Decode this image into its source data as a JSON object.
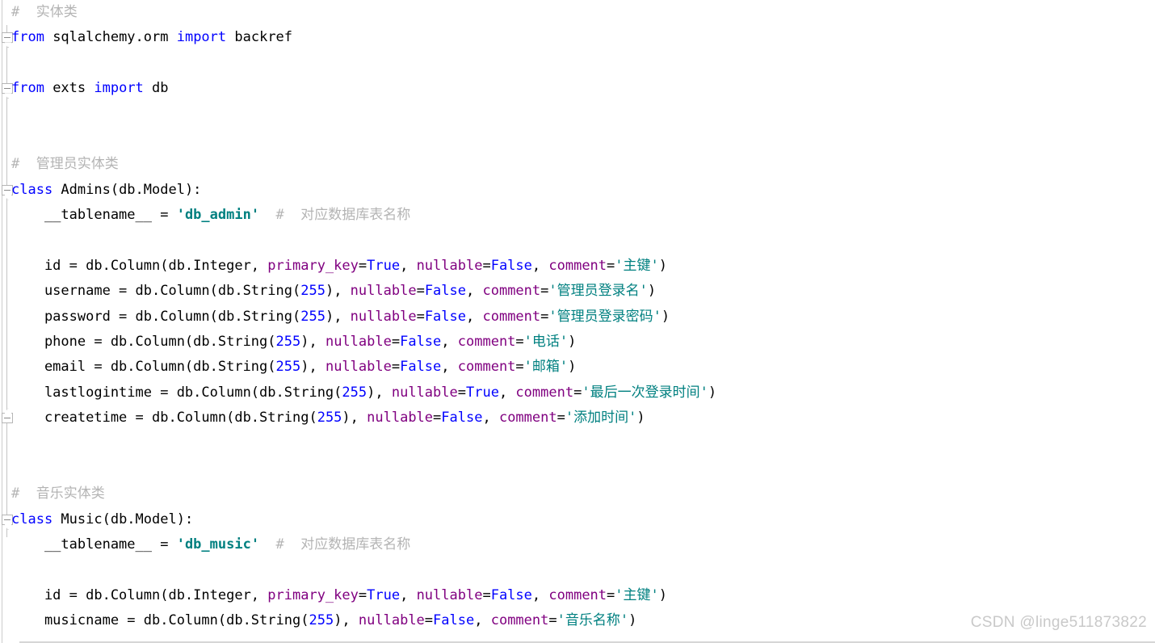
{
  "editor": {
    "background": "#ffffff",
    "font_size_px": 17,
    "line_height_px": 31.4,
    "colors": {
      "keyword": "#0000ff",
      "identifier": "#000000",
      "string": "#008080",
      "number": "#0000ff",
      "boolean": "#0000ff",
      "keyword_argument": "#800080",
      "comment": "#b4b4b4",
      "gutter_rule": "#cccccc",
      "fold_marker": "#b5b5b5",
      "watermark": "#c9c9c9"
    }
  },
  "watermark": {
    "text": "CSDN @linge511873822"
  },
  "gutter": {
    "fold_markers": [
      {
        "type": "start",
        "line_index": 1,
        "title": "collapse-region"
      },
      {
        "type": "start",
        "line_index": 3,
        "title": "collapse-region"
      },
      {
        "type": "start",
        "line_index": 7,
        "title": "collapse-region"
      },
      {
        "type": "end",
        "line_index": 16,
        "title": "end-of-region"
      },
      {
        "type": "start",
        "line_index": 20,
        "title": "collapse-region"
      }
    ]
  },
  "code": {
    "language": "python",
    "lines": [
      {
        "index": 0,
        "tokens": [
          {
            "t": "cm",
            "v": "# "
          },
          {
            "t": "cm",
            "v": " 实体类"
          }
        ]
      },
      {
        "index": 1,
        "tokens": [
          {
            "t": "kw",
            "v": "from"
          },
          {
            "t": "id",
            "v": " sqlalchemy.orm "
          },
          {
            "t": "kw",
            "v": "import"
          },
          {
            "t": "id",
            "v": " backref"
          }
        ]
      },
      {
        "index": 2,
        "tokens": []
      },
      {
        "index": 3,
        "tokens": [
          {
            "t": "kw",
            "v": "from"
          },
          {
            "t": "id",
            "v": " exts "
          },
          {
            "t": "kw",
            "v": "import"
          },
          {
            "t": "id",
            "v": " db"
          }
        ]
      },
      {
        "index": 4,
        "tokens": []
      },
      {
        "index": 5,
        "tokens": []
      },
      {
        "index": 6,
        "tokens": [
          {
            "t": "cm",
            "v": "# "
          },
          {
            "t": "cm",
            "v": " 管理员实体类"
          }
        ]
      },
      {
        "index": 7,
        "tokens": [
          {
            "t": "kw",
            "v": "class"
          },
          {
            "t": "id",
            "v": " Admins(db.Model):"
          }
        ]
      },
      {
        "index": 8,
        "tokens": [
          {
            "t": "id",
            "v": "    __tablename__ = "
          },
          {
            "t": "strb",
            "v": "'db_admin'"
          },
          {
            "t": "cm",
            "v": "  # "
          },
          {
            "t": "cm",
            "v": " 对应数据库表名称"
          }
        ]
      },
      {
        "index": 9,
        "tokens": []
      },
      {
        "index": 10,
        "tokens": [
          {
            "t": "id",
            "v": "    id = db.Column(db.Integer, "
          },
          {
            "t": "arg",
            "v": "primary_key"
          },
          {
            "t": "pn",
            "v": "="
          },
          {
            "t": "bool",
            "v": "True"
          },
          {
            "t": "pn",
            "v": ", "
          },
          {
            "t": "arg",
            "v": "nullable"
          },
          {
            "t": "pn",
            "v": "="
          },
          {
            "t": "bool",
            "v": "False"
          },
          {
            "t": "pn",
            "v": ", "
          },
          {
            "t": "arg",
            "v": "comment"
          },
          {
            "t": "pn",
            "v": "="
          },
          {
            "t": "str",
            "v": "'主键'"
          },
          {
            "t": "pn",
            "v": ")"
          }
        ]
      },
      {
        "index": 11,
        "tokens": [
          {
            "t": "id",
            "v": "    username = db.Column(db.String("
          },
          {
            "t": "num",
            "v": "255"
          },
          {
            "t": "pn",
            "v": "), "
          },
          {
            "t": "arg",
            "v": "nullable"
          },
          {
            "t": "pn",
            "v": "="
          },
          {
            "t": "bool",
            "v": "False"
          },
          {
            "t": "pn",
            "v": ", "
          },
          {
            "t": "arg",
            "v": "comment"
          },
          {
            "t": "pn",
            "v": "="
          },
          {
            "t": "str",
            "v": "'管理员登录名'"
          },
          {
            "t": "pn",
            "v": ")"
          }
        ]
      },
      {
        "index": 12,
        "tokens": [
          {
            "t": "id",
            "v": "    password = db.Column(db.String("
          },
          {
            "t": "num",
            "v": "255"
          },
          {
            "t": "pn",
            "v": "), "
          },
          {
            "t": "arg",
            "v": "nullable"
          },
          {
            "t": "pn",
            "v": "="
          },
          {
            "t": "bool",
            "v": "False"
          },
          {
            "t": "pn",
            "v": ", "
          },
          {
            "t": "arg",
            "v": "comment"
          },
          {
            "t": "pn",
            "v": "="
          },
          {
            "t": "str",
            "v": "'管理员登录密码'"
          },
          {
            "t": "pn",
            "v": ")"
          }
        ]
      },
      {
        "index": 13,
        "tokens": [
          {
            "t": "id",
            "v": "    phone = db.Column(db.String("
          },
          {
            "t": "num",
            "v": "255"
          },
          {
            "t": "pn",
            "v": "), "
          },
          {
            "t": "arg",
            "v": "nullable"
          },
          {
            "t": "pn",
            "v": "="
          },
          {
            "t": "bool",
            "v": "False"
          },
          {
            "t": "pn",
            "v": ", "
          },
          {
            "t": "arg",
            "v": "comment"
          },
          {
            "t": "pn",
            "v": "="
          },
          {
            "t": "str",
            "v": "'电话'"
          },
          {
            "t": "pn",
            "v": ")"
          }
        ]
      },
      {
        "index": 14,
        "tokens": [
          {
            "t": "id",
            "v": "    email = db.Column(db.String("
          },
          {
            "t": "num",
            "v": "255"
          },
          {
            "t": "pn",
            "v": "), "
          },
          {
            "t": "arg",
            "v": "nullable"
          },
          {
            "t": "pn",
            "v": "="
          },
          {
            "t": "bool",
            "v": "False"
          },
          {
            "t": "pn",
            "v": ", "
          },
          {
            "t": "arg",
            "v": "comment"
          },
          {
            "t": "pn",
            "v": "="
          },
          {
            "t": "str",
            "v": "'邮箱'"
          },
          {
            "t": "pn",
            "v": ")"
          }
        ]
      },
      {
        "index": 15,
        "tokens": [
          {
            "t": "id",
            "v": "    lastlogintime = db.Column(db.String("
          },
          {
            "t": "num",
            "v": "255"
          },
          {
            "t": "pn",
            "v": "), "
          },
          {
            "t": "arg",
            "v": "nullable"
          },
          {
            "t": "pn",
            "v": "="
          },
          {
            "t": "bool",
            "v": "True"
          },
          {
            "t": "pn",
            "v": ", "
          },
          {
            "t": "arg",
            "v": "comment"
          },
          {
            "t": "pn",
            "v": "="
          },
          {
            "t": "str",
            "v": "'最后一次登录时间'"
          },
          {
            "t": "pn",
            "v": ")"
          }
        ]
      },
      {
        "index": 16,
        "tokens": [
          {
            "t": "id",
            "v": "    createtime = db.Column(db.String("
          },
          {
            "t": "num",
            "v": "255"
          },
          {
            "t": "pn",
            "v": "), "
          },
          {
            "t": "arg",
            "v": "nullable"
          },
          {
            "t": "pn",
            "v": "="
          },
          {
            "t": "bool",
            "v": "False"
          },
          {
            "t": "pn",
            "v": ", "
          },
          {
            "t": "arg",
            "v": "comment"
          },
          {
            "t": "pn",
            "v": "="
          },
          {
            "t": "str",
            "v": "'添加时间'"
          },
          {
            "t": "pn",
            "v": ")"
          }
        ]
      },
      {
        "index": 17,
        "tokens": []
      },
      {
        "index": 18,
        "tokens": []
      },
      {
        "index": 19,
        "tokens": [
          {
            "t": "cm",
            "v": "# "
          },
          {
            "t": "cm",
            "v": " 音乐实体类"
          }
        ]
      },
      {
        "index": 20,
        "tokens": [
          {
            "t": "kw",
            "v": "class"
          },
          {
            "t": "id",
            "v": " Music(db.Model):"
          }
        ]
      },
      {
        "index": 21,
        "tokens": [
          {
            "t": "id",
            "v": "    __tablename__ = "
          },
          {
            "t": "strb",
            "v": "'db_music'"
          },
          {
            "t": "cm",
            "v": "  # "
          },
          {
            "t": "cm",
            "v": " 对应数据库表名称"
          }
        ]
      },
      {
        "index": 22,
        "tokens": []
      },
      {
        "index": 23,
        "tokens": [
          {
            "t": "id",
            "v": "    id = db.Column(db.Integer, "
          },
          {
            "t": "arg",
            "v": "primary_key"
          },
          {
            "t": "pn",
            "v": "="
          },
          {
            "t": "bool",
            "v": "True"
          },
          {
            "t": "pn",
            "v": ", "
          },
          {
            "t": "arg",
            "v": "nullable"
          },
          {
            "t": "pn",
            "v": "="
          },
          {
            "t": "bool",
            "v": "False"
          },
          {
            "t": "pn",
            "v": ", "
          },
          {
            "t": "arg",
            "v": "comment"
          },
          {
            "t": "pn",
            "v": "="
          },
          {
            "t": "str",
            "v": "'主键'"
          },
          {
            "t": "pn",
            "v": ")"
          }
        ]
      },
      {
        "index": 24,
        "tokens": [
          {
            "t": "id",
            "v": "    musicname = db.Column(db.String("
          },
          {
            "t": "num",
            "v": "255"
          },
          {
            "t": "pn",
            "v": "), "
          },
          {
            "t": "arg",
            "v": "nullable"
          },
          {
            "t": "pn",
            "v": "="
          },
          {
            "t": "bool",
            "v": "False"
          },
          {
            "t": "pn",
            "v": ", "
          },
          {
            "t": "arg",
            "v": "comment"
          },
          {
            "t": "pn",
            "v": "="
          },
          {
            "t": "str",
            "v": "'音乐名称'"
          },
          {
            "t": "pn",
            "v": ")"
          }
        ]
      }
    ]
  }
}
